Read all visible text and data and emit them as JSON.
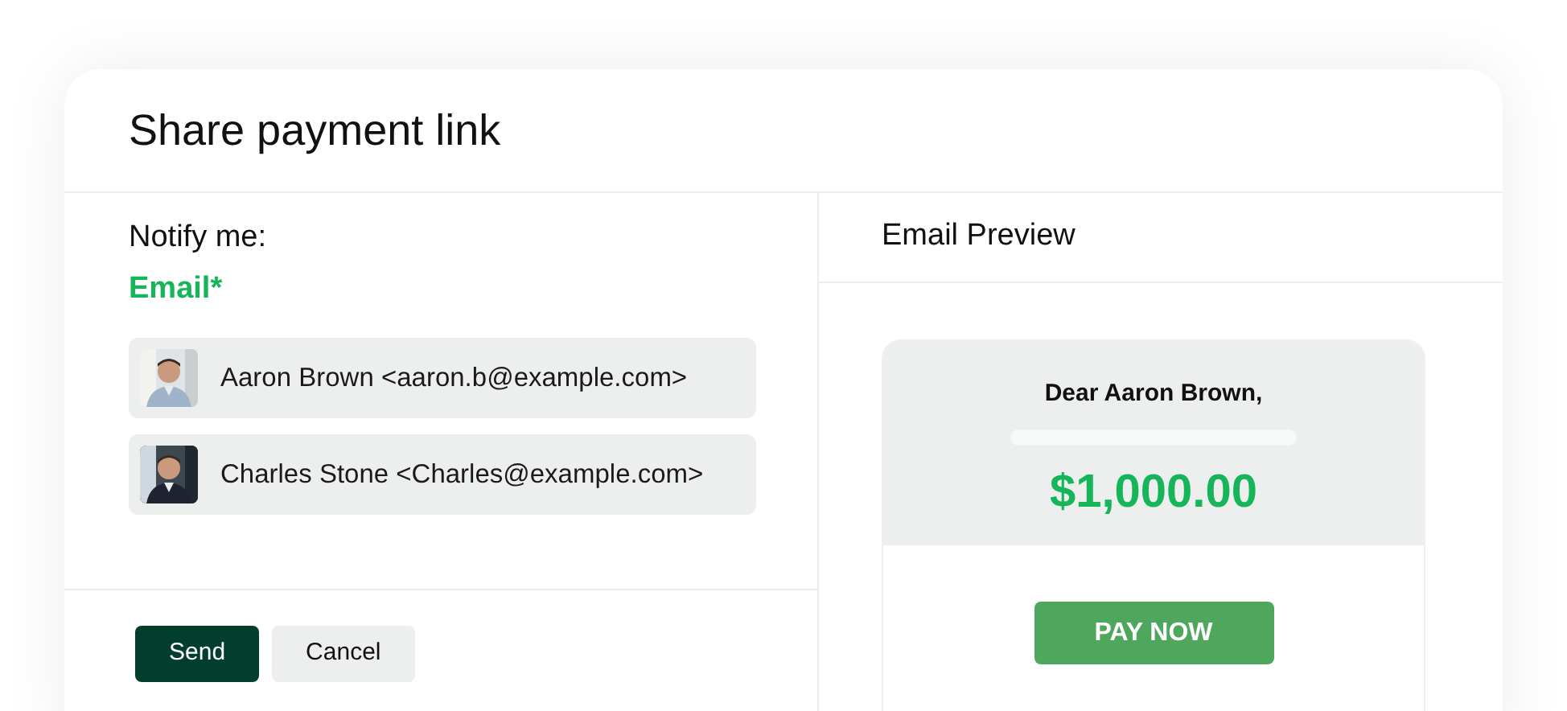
{
  "dialog": {
    "title": "Share payment link"
  },
  "notify": {
    "label": "Notify me:",
    "field_label": "Email*",
    "recipients": [
      {
        "text": "Aaron Brown <aaron.b@example.com>"
      },
      {
        "text": "Charles Stone <Charles@example.com>"
      }
    ]
  },
  "buttons": [
    {
      "label": "Send",
      "kind": "primary"
    },
    {
      "label": "Cancel",
      "kind": "secondary"
    }
  ],
  "preview": {
    "title": "Email Preview",
    "greeting": "Dear Aaron Brown,",
    "amount": "$1,000.00",
    "pay_button": "PAY NOW"
  }
}
